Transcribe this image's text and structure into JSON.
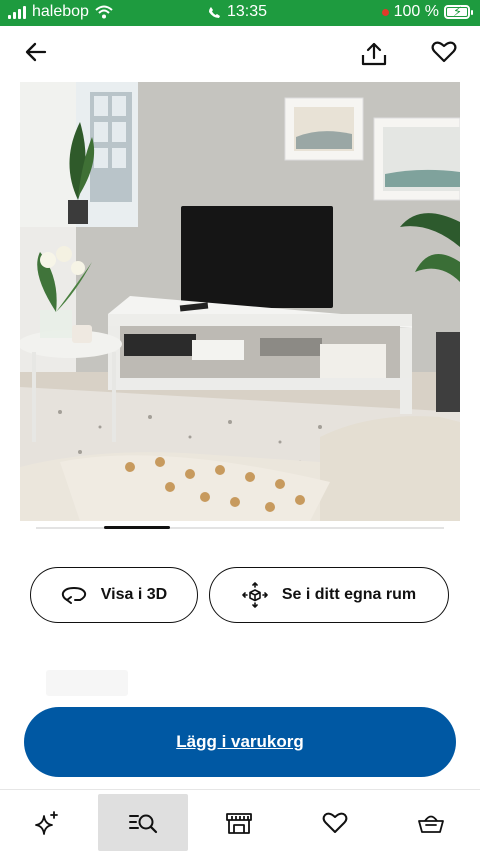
{
  "status_bar": {
    "carrier": "halebop",
    "time": "13:35",
    "battery": "100 %"
  },
  "header": {
    "back_icon": "arrow-left-icon",
    "share_icon": "share-icon",
    "favorite_icon": "heart-icon"
  },
  "product_image": {
    "alt": "TV-bänk"
  },
  "carousel": {
    "current_index": 1,
    "total": 6
  },
  "actions": {
    "view_3d_label": "Visa i 3D",
    "view_room_label": "Se i ditt egna rum"
  },
  "cart": {
    "add_label": "Lägg i varukorg"
  },
  "bottom_nav": {
    "items": [
      {
        "icon": "sparkle-icon",
        "active": false
      },
      {
        "icon": "search-list-icon",
        "active": true
      },
      {
        "icon": "store-icon",
        "active": false
      },
      {
        "icon": "heart-icon",
        "active": false
      },
      {
        "icon": "basket-icon",
        "active": false
      }
    ]
  },
  "colors": {
    "status_bar": "#1e9b3f",
    "primary": "#0058a3"
  }
}
